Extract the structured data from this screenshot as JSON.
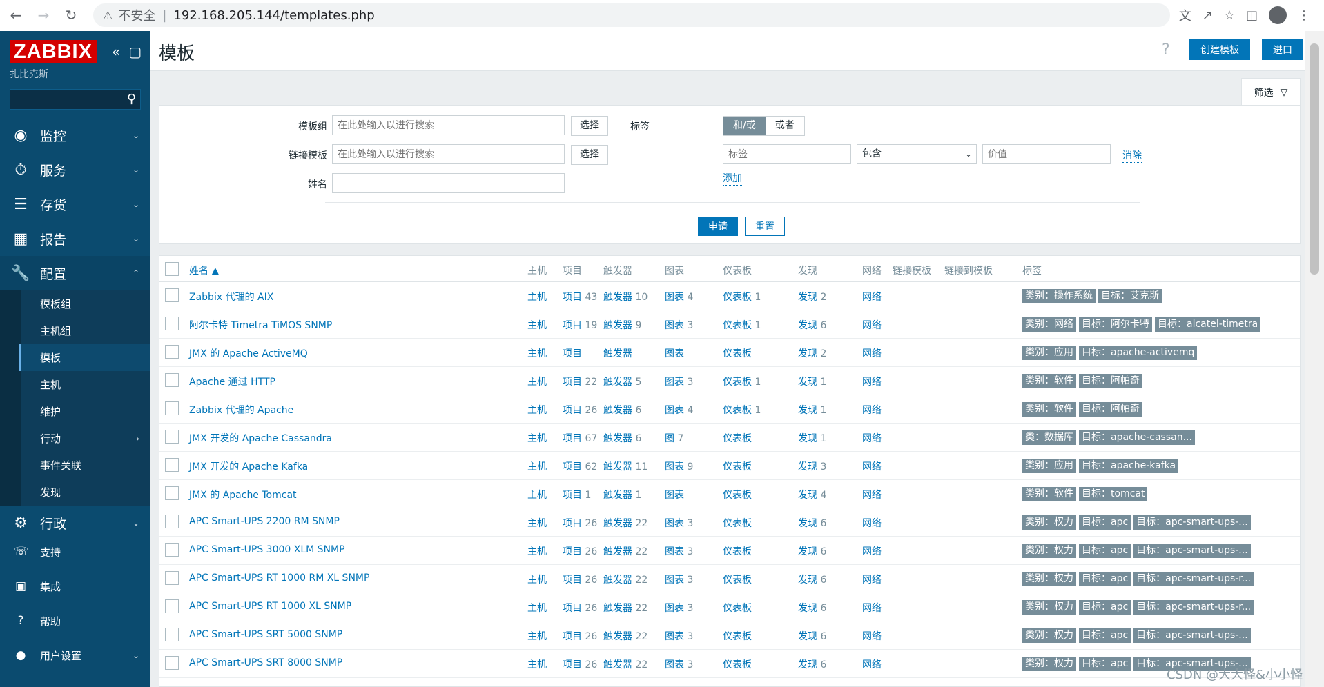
{
  "browser": {
    "security_label": "不安全",
    "separator": "|",
    "url": "192.168.205.144/templates.php"
  },
  "sidebar": {
    "logo": "ZABBIX",
    "server_name": "扎比克斯",
    "menu": [
      {
        "label": "监控",
        "icon": "eye-icon"
      },
      {
        "label": "服务",
        "icon": "stopwatch-icon"
      },
      {
        "label": "存货",
        "icon": "list-icon"
      },
      {
        "label": "报告",
        "icon": "bar-chart-icon"
      },
      {
        "label": "配置",
        "icon": "wrench-icon"
      }
    ],
    "submenu": [
      "模板组",
      "主机组",
      "模板",
      "主机",
      "维护",
      "行动",
      "事件关联",
      "发现"
    ],
    "admin": "行政",
    "bottom": [
      "支持",
      "集成",
      "帮助",
      "用户设置"
    ]
  },
  "header": {
    "title": "模板",
    "help": "?",
    "create_button": "创建模板",
    "import_button": "进口"
  },
  "filter": {
    "tab_label": "筛选",
    "template_group_label": "模板组",
    "template_group_placeholder": "在此处输入以进行搜索",
    "linked_template_label": "链接模板",
    "linked_template_placeholder": "在此处输入以进行搜索",
    "name_label": "姓名",
    "select_label": "选择",
    "tags_label": "标签",
    "and_or": "和/或",
    "or": "或者",
    "tag_placeholder": "标签",
    "operator": "包含",
    "value_placeholder": "价值",
    "remove": "消除",
    "add": "添加",
    "apply": "申请",
    "reset": "重置"
  },
  "table": {
    "headers": {
      "name": "姓名 ▲",
      "hosts": "主机",
      "items": "项目",
      "triggers": "触发器",
      "graphs": "图表",
      "dashboards": "仪表板",
      "discovery": "发现",
      "web": "网络",
      "linked_templates": "链接模板",
      "linked_to": "链接到模板",
      "tags": "标签"
    },
    "rows": [
      {
        "name": "Zabbix 代理的 AIX",
        "hosts": "主机",
        "items": "项目",
        "items_n": "43",
        "triggers": "触发器",
        "triggers_n": "10",
        "graphs": "图表",
        "graphs_n": "4",
        "dash": "仪表板",
        "dash_n": "1",
        "disc": "发现",
        "disc_n": "2",
        "web": "网络",
        "tags": [
          "类别：操作系统",
          "目标：艾克斯"
        ]
      },
      {
        "name": "阿尔卡特 Timetra TiMOS SNMP",
        "hosts": "主机",
        "items": "项目",
        "items_n": "19",
        "triggers": "触发器",
        "triggers_n": "9",
        "graphs": "图表",
        "graphs_n": "3",
        "dash": "仪表板",
        "dash_n": "1",
        "disc": "发现",
        "disc_n": "6",
        "web": "网络",
        "tags": [
          "类别：网络",
          "目标：阿尔卡特",
          "目标：alcatel-timetra"
        ]
      },
      {
        "name": "JMX 的 Apache ActiveMQ",
        "hosts": "主机",
        "items": "项目",
        "items_n": "",
        "triggers": "触发器",
        "triggers_n": "",
        "graphs": "图表",
        "graphs_n": "",
        "dash": "仪表板",
        "dash_n": "",
        "disc": "发现",
        "disc_n": "2",
        "web": "网络",
        "tags": [
          "类别：应用",
          "目标：apache-activemq"
        ]
      },
      {
        "name": "Apache 通过 HTTP",
        "hosts": "主机",
        "items": "项目",
        "items_n": "22",
        "triggers": "触发器",
        "triggers_n": "5",
        "graphs": "图表",
        "graphs_n": "3",
        "dash": "仪表板",
        "dash_n": "1",
        "disc": "发现",
        "disc_n": "1",
        "web": "网络",
        "tags": [
          "类别：软件",
          "目标：阿帕奇"
        ]
      },
      {
        "name": "Zabbix 代理的 Apache",
        "hosts": "主机",
        "items": "项目",
        "items_n": "26",
        "triggers": "触发器",
        "triggers_n": "6",
        "graphs": "图表",
        "graphs_n": "4",
        "dash": "仪表板",
        "dash_n": "1",
        "disc": "发现",
        "disc_n": "1",
        "web": "网络",
        "tags": [
          "类别：软件",
          "目标：阿帕奇"
        ]
      },
      {
        "name": "JMX 开发的 Apache Cassandra",
        "hosts": "主机",
        "items": "项目",
        "items_n": "67",
        "triggers": "触发器",
        "triggers_n": "6",
        "graphs": "图",
        "graphs_n": "7",
        "dash": "仪表板",
        "dash_n": "",
        "disc": "发现",
        "disc_n": "1",
        "web": "网络",
        "tags": [
          "类：数据库",
          "目标：apache-cassan..."
        ]
      },
      {
        "name": "JMX 开发的 Apache Kafka",
        "hosts": "主机",
        "items": "项目",
        "items_n": "62",
        "triggers": "触发器",
        "triggers_n": "11",
        "graphs": "图表",
        "graphs_n": "9",
        "dash": "仪表板",
        "dash_n": "",
        "disc": "发现",
        "disc_n": "3",
        "web": "网络",
        "tags": [
          "类别：应用",
          "目标：apache-kafka"
        ]
      },
      {
        "name": "JMX 的 Apache Tomcat",
        "hosts": "主机",
        "items": "项目",
        "items_n": "1",
        "triggers": "触发器",
        "triggers_n": "1",
        "graphs": "图表",
        "graphs_n": "",
        "dash": "仪表板",
        "dash_n": "",
        "disc": "发现",
        "disc_n": "4",
        "web": "网络",
        "tags": [
          "类别：软件",
          "目标：tomcat"
        ]
      },
      {
        "name": "APC Smart-UPS 2200 RM SNMP",
        "hosts": "主机",
        "items": "项目",
        "items_n": "26",
        "triggers": "触发器",
        "triggers_n": "22",
        "graphs": "图表",
        "graphs_n": "3",
        "dash": "仪表板",
        "dash_n": "",
        "disc": "发现",
        "disc_n": "6",
        "web": "网络",
        "tags": [
          "类别：权力",
          "目标：apc",
          "目标：apc-smart-ups-..."
        ]
      },
      {
        "name": "APC Smart-UPS 3000 XLM SNMP",
        "hosts": "主机",
        "items": "项目",
        "items_n": "26",
        "triggers": "触发器",
        "triggers_n": "22",
        "graphs": "图表",
        "graphs_n": "3",
        "dash": "仪表板",
        "dash_n": "",
        "disc": "发现",
        "disc_n": "6",
        "web": "网络",
        "tags": [
          "类别：权力",
          "目标：apc",
          "目标：apc-smart-ups-..."
        ]
      },
      {
        "name": "APC Smart-UPS RT 1000 RM XL SNMP",
        "hosts": "主机",
        "items": "项目",
        "items_n": "26",
        "triggers": "触发器",
        "triggers_n": "22",
        "graphs": "图表",
        "graphs_n": "3",
        "dash": "仪表板",
        "dash_n": "",
        "disc": "发现",
        "disc_n": "6",
        "web": "网络",
        "tags": [
          "类别：权力",
          "目标：apc",
          "目标：apc-smart-ups-r..."
        ]
      },
      {
        "name": "APC Smart-UPS RT 1000 XL SNMP",
        "hosts": "主机",
        "items": "项目",
        "items_n": "26",
        "triggers": "触发器",
        "triggers_n": "22",
        "graphs": "图表",
        "graphs_n": "3",
        "dash": "仪表板",
        "dash_n": "",
        "disc": "发现",
        "disc_n": "6",
        "web": "网络",
        "tags": [
          "类别：权力",
          "目标：apc",
          "目标：apc-smart-ups-r..."
        ]
      },
      {
        "name": "APC Smart-UPS SRT 5000 SNMP",
        "hosts": "主机",
        "items": "项目",
        "items_n": "26",
        "triggers": "触发器",
        "triggers_n": "22",
        "graphs": "图表",
        "graphs_n": "3",
        "dash": "仪表板",
        "dash_n": "",
        "disc": "发现",
        "disc_n": "6",
        "web": "网络",
        "tags": [
          "类别：权力",
          "目标：apc",
          "目标：apc-smart-ups-..."
        ]
      },
      {
        "name": "APC Smart-UPS SRT 8000 SNMP",
        "hosts": "主机",
        "items": "项目",
        "items_n": "26",
        "triggers": "触发器",
        "triggers_n": "22",
        "graphs": "图表",
        "graphs_n": "3",
        "dash": "仪表板",
        "dash_n": "",
        "disc": "发现",
        "disc_n": "6",
        "web": "网络",
        "tags": [
          "类别：权力",
          "目标：apc",
          "目标：apc-smart-ups-..."
        ]
      }
    ]
  },
  "watermark": "CSDN @大大怪&小小怪"
}
